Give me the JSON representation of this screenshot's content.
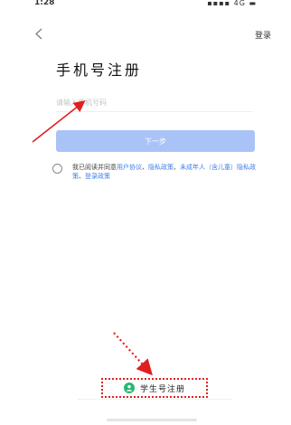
{
  "status_bar": {
    "time": "1:28",
    "icons": "▪▪▪▪ 4G ▬"
  },
  "header": {
    "login_label": "登录"
  },
  "page_title": "手机号注册",
  "phone_input": {
    "value": "",
    "placeholder": "请输入手机号码"
  },
  "next_button_label": "下一步",
  "agreement": {
    "prefix": "我已阅读并同意",
    "link1": "用户协议",
    "sep1": "、",
    "link2": "隐私政策",
    "sep2": "、",
    "link3": "未成年人（含儿童）隐私政策",
    "sep3": "、",
    "link4": "登录政策",
    "checked": false
  },
  "student_register_label": "学生号注册",
  "colors": {
    "accent_button": "#aac3f6",
    "link": "#3f7de8",
    "annotation_red": "#e02020",
    "student_icon": "#2bb673"
  },
  "icons": [
    "back-chevron-icon",
    "radio-unchecked-icon",
    "student-user-icon",
    "annotation-arrow-icon"
  ]
}
